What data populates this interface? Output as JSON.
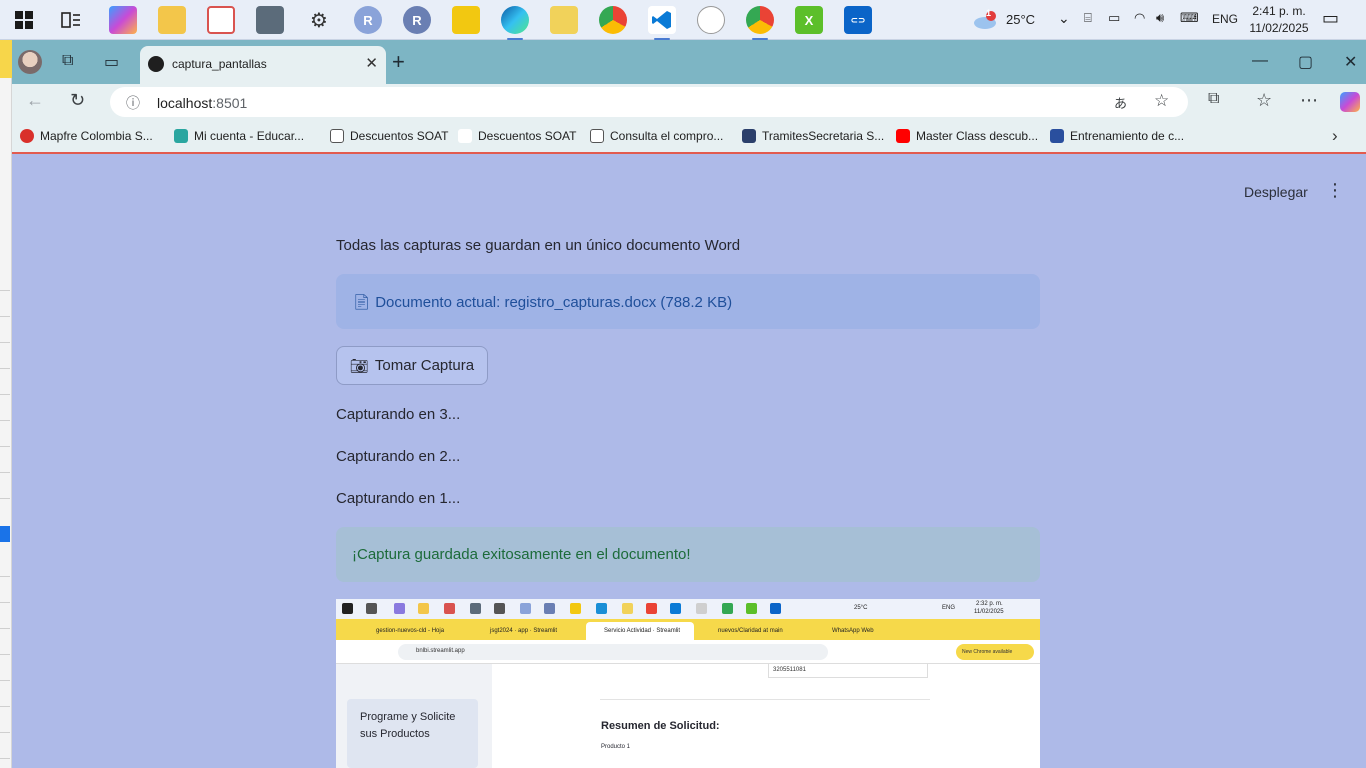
{
  "taskbar": {
    "weather_badge": "1",
    "temperature": "25°C",
    "language": "ENG",
    "time": "2:41 p. m.",
    "date": "11/02/2025"
  },
  "browser": {
    "tab_title": "captura_pantallas",
    "url_host": "localhost",
    "url_port": ":8501",
    "bookmarks": [
      "Mapfre Colombia S...",
      "Mi cuenta - Educar...",
      "Descuentos SOAT",
      "Descuentos SOAT",
      "Consulta el compro...",
      "TramitesSecretaria S...",
      "Master Class descub...",
      "Entrenamiento de c..."
    ]
  },
  "page": {
    "deploy_label": "Desplegar",
    "intro": "Todas las capturas se guardan en un único documento Word",
    "doc_info": "Documento actual: registro_capturas.docx (788.2 KB)",
    "capture_button": "Tomar Captura",
    "countdown": [
      "Capturando en 3...",
      "Capturando en 2...",
      "Capturando en 1..."
    ],
    "success": "¡Captura guardada exitosamente en el documento!"
  },
  "screenshot": {
    "temperature": "25°C",
    "language": "ENG",
    "time": "2:32 p. m.",
    "date": "11/02/2025",
    "tabs": [
      "gestion-nuevos-cld - Hoja",
      "jsgt2024 · app · Streamlit",
      "Servicio Actividad · Streamlit",
      "nuevos/Claridad at main",
      "WhatsApp Web"
    ],
    "url": "bnlbi.streamlit.app",
    "new_chrome": "New Chrome available",
    "phone": "3205511081",
    "sidebar_item": "Programe y Solicite sus Productos",
    "summary_title": "Resumen de Solicitud:",
    "product": "Producto 1"
  },
  "colors": {
    "page_bg": "#aebae8",
    "info_bg": "#9fb3e6",
    "success_bg": "#a6bfd6",
    "tab_bar": "#7db5c4",
    "bookmark_border": "#e25b4f"
  }
}
